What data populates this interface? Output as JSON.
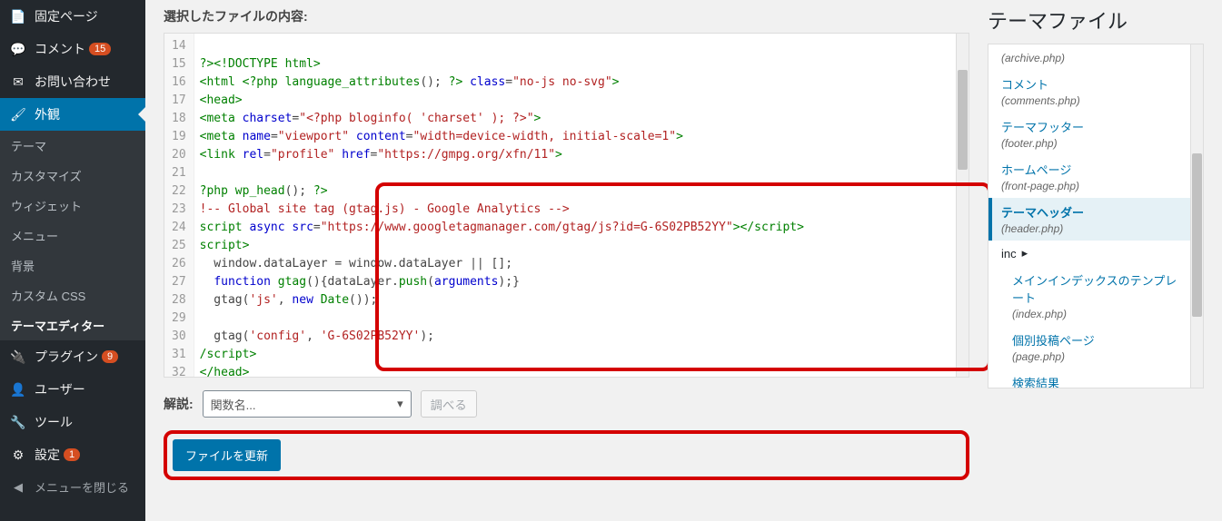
{
  "sidebar": {
    "items": [
      {
        "icon": "page",
        "label": "固定ページ"
      },
      {
        "icon": "comment",
        "label": "コメント",
        "badge": "15"
      },
      {
        "icon": "mail",
        "label": "お問い合わせ"
      },
      {
        "icon": "brush",
        "label": "外観",
        "active": true
      },
      {
        "icon": "plugin",
        "label": "プラグイン",
        "badge": "9"
      },
      {
        "icon": "user",
        "label": "ユーザー"
      },
      {
        "icon": "tool",
        "label": "ツール"
      },
      {
        "icon": "settings",
        "label": "設定",
        "badge": "1"
      }
    ],
    "submenu": [
      "テーマ",
      "カスタマイズ",
      "ウィジェット",
      "メニュー",
      "背景",
      "カスタム CSS",
      "テーマエディター"
    ],
    "submenu_active": 6,
    "collapse": "メニューを閉じる"
  },
  "main": {
    "heading": "選択したファイルの内容:",
    "code_lines": [
      {
        "n": 14,
        "html": ""
      },
      {
        "n": 15,
        "html": "<span class='t-tag'>?&gt;&lt;!DOCTYPE html&gt;</span>"
      },
      {
        "n": 16,
        "html": "<span class='t-tag'>&lt;html</span> <span class='t-tag'>&lt;?php</span> <span class='t-func'>language_attributes</span>(); <span class='t-tag'>?&gt;</span> <span class='t-attr'>class</span>=<span class='t-str'>\"no-js no-svg\"</span><span class='t-tag'>&gt;</span>"
      },
      {
        "n": 17,
        "html": "<span class='t-tag'>&lt;head&gt;</span>"
      },
      {
        "n": 18,
        "html": "<span class='t-tag'>&lt;meta</span> <span class='t-attr'>charset</span>=<span class='t-str'>\"&lt;?php bloginfo( 'charset' ); ?&gt;\"</span><span class='t-tag'>&gt;</span>"
      },
      {
        "n": 19,
        "html": "<span class='t-tag'>&lt;meta</span> <span class='t-attr'>name</span>=<span class='t-str'>\"viewport\"</span> <span class='t-attr'>content</span>=<span class='t-str'>\"width=device-width, initial-scale=1\"</span><span class='t-tag'>&gt;</span>"
      },
      {
        "n": 20,
        "html": "<span class='t-tag'>&lt;link</span> <span class='t-attr'>rel</span>=<span class='t-str'>\"profile\"</span> <span class='t-attr'>href</span>=<span class='t-str'>\"https://gmpg.org/xfn/11\"</span><span class='t-tag'>&gt;</span>"
      },
      {
        "n": 21,
        "html": ""
      },
      {
        "n": 22,
        "html": "<span class='t-tag'>?php</span> <span class='t-func'>wp_head</span>(); <span class='t-tag'>?&gt;</span>"
      },
      {
        "n": 23,
        "html": "<span class='t-comment'>!-- Global site tag (gtag.js) - Google Analytics --&gt;</span>"
      },
      {
        "n": 24,
        "html": "<span class='t-tag'>script</span> <span class='t-attr'>async src</span>=<span class='t-str'>\"https://www.googletagmanager.com/gtag/js?id=G-6S02PB52YY\"</span><span class='t-tag'>&gt;&lt;/script&gt;</span>"
      },
      {
        "n": 25,
        "html": "<span class='t-tag'>script&gt;</span>"
      },
      {
        "n": 26,
        "html": "  window.dataLayer = window.dataLayer || [];"
      },
      {
        "n": 27,
        "html": "  <span class='t-keyword'>function</span> <span class='t-func'>gtag</span>(){dataLayer.<span class='t-func'>push</span>(<span class='t-attr'>arguments</span>);}"
      },
      {
        "n": 28,
        "html": "  gtag(<span class='t-str'>'js'</span>, <span class='t-keyword'>new</span> <span class='t-func'>Date</span>());"
      },
      {
        "n": 29,
        "html": ""
      },
      {
        "n": 30,
        "html": "  gtag(<span class='t-str'>'config'</span>, <span class='t-str'>'G-6S02PB52YY'</span>);"
      },
      {
        "n": 31,
        "html": "<span class='t-tag'>/script&gt;</span>",
        "hl": true
      },
      {
        "n": 32,
        "html": "<span class='t-tag'>&lt;/head&gt;</span>"
      }
    ],
    "explain_label": "解説:",
    "func_placeholder": "関数名...",
    "lookup": "調べる",
    "update": "ファイルを更新"
  },
  "right": {
    "heading": "テーマファイル",
    "files": [
      {
        "note": "(archive.php)",
        "noteonly": true
      },
      {
        "title": "コメント",
        "note": "(comments.php)"
      },
      {
        "title": "テーマフッター",
        "note": "(footer.php)"
      },
      {
        "title": "ホームページ",
        "note": "(front-page.php)"
      },
      {
        "title": "テーマヘッダー",
        "note": "(header.php)",
        "current": true
      },
      {
        "folder": "inc"
      },
      {
        "title": "メインインデックスのテンプレート",
        "note": "(index.php)",
        "sub": true
      },
      {
        "title": "個別投稿ページ",
        "note": "(page.php)",
        "sub": true
      },
      {
        "title": "検索結果",
        "sub": true,
        "cut": true
      }
    ]
  }
}
